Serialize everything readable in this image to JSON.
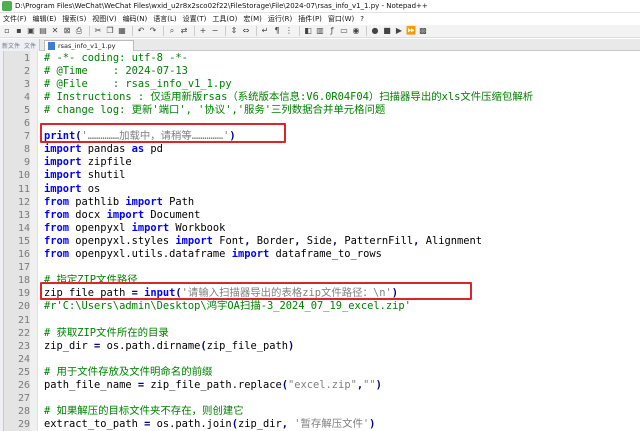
{
  "window": {
    "title": "D:\\Program Files\\WeChat\\WeChat Files\\wxid_u2r8x2sco02f22\\FileStorage\\File\\2024-07\\rsas_info_v1_1.py - Notepad++"
  },
  "menubar": {
    "items": [
      "文件(F)",
      "编辑(E)",
      "搜索(S)",
      "视图(V)",
      "编码(N)",
      "语言(L)",
      "设置(T)",
      "工具(O)",
      "宏(M)",
      "运行(R)",
      "插件(P)",
      "窗口(W)",
      "?"
    ]
  },
  "toolbar": {
    "buttons": [
      "new-file-icon",
      "open-file-icon",
      "save-icon",
      "save-all-icon",
      "close-icon",
      "close-all-icon",
      "print-icon",
      "cut-icon",
      "copy-icon",
      "paste-icon",
      "undo-icon",
      "redo-icon",
      "find-icon",
      "replace-icon",
      "zoom-in-icon",
      "zoom-out-icon",
      "sync-v-icon",
      "sync-h-icon",
      "wrap-icon",
      "all-chars-icon",
      "indent-guide-icon",
      "lang-icon",
      "doc-map-icon",
      "func-list-icon",
      "folder-icon",
      "monitor-icon",
      "record-icon",
      "stop-icon",
      "play-icon",
      "play-multi-icon",
      "save-macro-icon"
    ]
  },
  "sidepanel": {
    "tabs": [
      "新文件",
      "文件"
    ]
  },
  "editor": {
    "tab_label": "rsas_info_v1_1.py",
    "line_numbers": [
      "1",
      "2",
      "3",
      "4",
      "5",
      "6",
      "7",
      "8",
      "9",
      "10",
      "11",
      "12",
      "13",
      "14",
      "15",
      "16",
      "17",
      "18",
      "19",
      "20",
      "21",
      "22",
      "23",
      "24",
      "25",
      "26",
      "27",
      "28",
      "29"
    ],
    "lines": [
      "# -*- coding: utf-8 -*-",
      "# @Time    : 2024-07-13",
      "# @File    : rsas_info_v1_1.py",
      "# Instructions : 仅适用新版rsas（系统版本信息:V6.0R04F04）扫描器导出的xls文件压缩包解析",
      "# change log: 更新'端口', '协议','服务'三列数据合并单元格问题",
      "",
      "print('……………加载中，请稍等……………')",
      "import pandas as pd",
      "import zipfile",
      "import shutil",
      "import os",
      "from pathlib import Path",
      "from docx import Document",
      "from openpyxl import Workbook",
      "from openpyxl.styles import Font, Border, Side, PatternFill, Alignment",
      "from openpyxl.utils.dataframe import dataframe_to_rows",
      "",
      "# 指定ZIP文件路径",
      "zip_file_path = input('请输入扫描器导出的表格zip文件路径：\\n')",
      "#r'C:\\Users\\admin\\Desktop\\鸿宇OA扫描-3_2024_07_19_excel.zip'",
      "",
      "# 获取ZIP文件所在的目录",
      "zip_dir = os.path.dirname(zip_file_path)",
      "",
      "# 用于文件存放及文件明命名的前缀",
      "path_file_name = zip_file_path.replace(\"excel.zip\",\"\")",
      "",
      "# 如果解压的目标文件夹不存在，则创建它",
      "extract_to_path = os.path.join(zip_dir, '暂存解压文件')"
    ]
  },
  "annotations": {
    "box_color": "#d9262b"
  }
}
